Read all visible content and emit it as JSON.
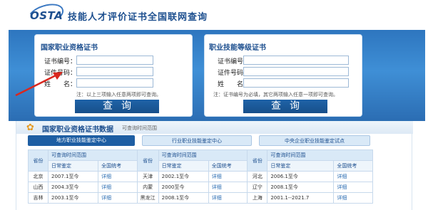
{
  "header": {
    "logo_text": "OSTA",
    "site_title": "技能人才评价证书全国联网查询"
  },
  "left_panel": {
    "title": "国家职业资格证书",
    "fields": [
      {
        "label": "证书编号：",
        "value": ""
      },
      {
        "label": "证件号码：",
        "value": ""
      },
      {
        "label": "姓　　名：",
        "value": ""
      }
    ],
    "note": "注：以上三项输入任意两项即可查询。",
    "button": "查询"
  },
  "right_panel": {
    "title": "职业技能等级证书",
    "fields": [
      {
        "label": "证书编号",
        "value": ""
      },
      {
        "label": "证件号码",
        "value": ""
      },
      {
        "label": "姓　　名",
        "value": ""
      }
    ],
    "note": "注：证书编号为必填，其它两项输入任意一项即可查询。",
    "button": "查询"
  },
  "data_section": {
    "title": "国家职业资格证书数据",
    "subtitle": "可查询时间范围",
    "tabs": [
      "地方职业技能鉴定中心",
      "行业职业技能鉴定中心",
      "中央企业职业技能鉴定试点"
    ]
  },
  "table": {
    "province_header": "省份",
    "range_header": "可查询时间范围",
    "sub_headers": [
      "日常鉴定",
      "全国统考"
    ],
    "rows": [
      [
        {
          "province": "北京",
          "range": "2007.1至今",
          "link": "详细"
        },
        {
          "province": "天津",
          "range": "2002.1至今",
          "link": "详细"
        },
        {
          "province": "河北",
          "range": "2006.1至今",
          "link": "详细"
        }
      ],
      [
        {
          "province": "山西",
          "range": "2004.3至今",
          "link": "详细"
        },
        {
          "province": "内蒙",
          "range": "2000至今",
          "link": "详细"
        },
        {
          "province": "辽宁",
          "range": "2008.1至今",
          "link": "详细"
        }
      ],
      [
        {
          "province": "吉林",
          "range": "2003.1至今",
          "link": "详细"
        },
        {
          "province": "黑龙江",
          "range": "2008.1至今",
          "link": "详细"
        },
        {
          "province": "上海",
          "range": "2001.1--2021.7",
          "link": "详细"
        }
      ]
    ]
  },
  "colors": {
    "brand_blue": "#1d4f8f",
    "banner_blue": "#3f8fd6",
    "button_blue": "#1f63a8",
    "arrow_red": "#d9271e"
  }
}
